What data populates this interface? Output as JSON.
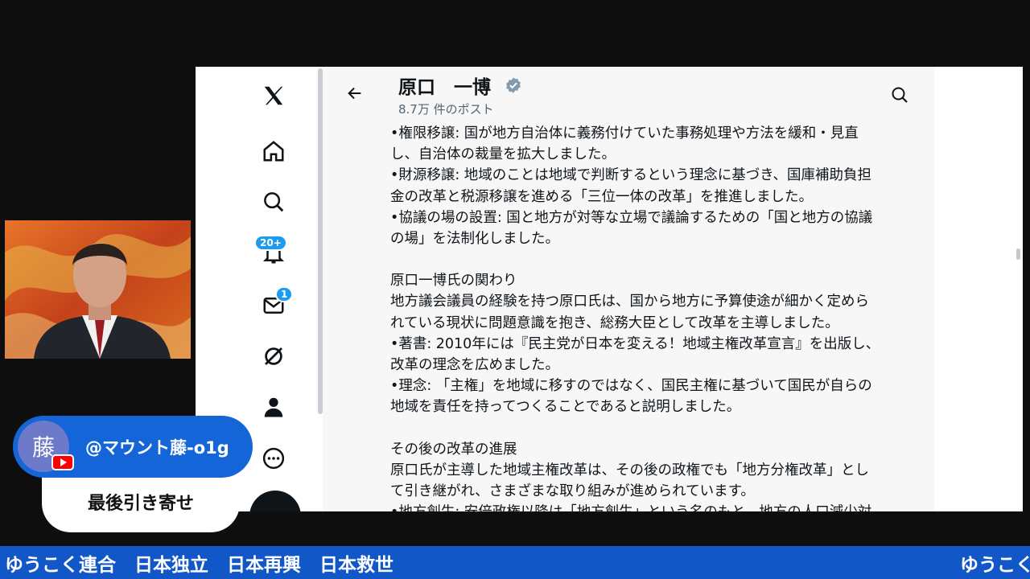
{
  "profile": {
    "name": "原口　一博",
    "post_count": "8.7万 件のポスト"
  },
  "nav": {
    "notifications_badge": "20+",
    "messages_badge": "1"
  },
  "article": {
    "lines": [
      "•権限移譲: 国が地方自治体に義務付けていた事務処理や方法を緩和・見直",
      "し、自治体の裁量を拡大しました。",
      "•財源移譲: 地域のことは地域で判断するという理念に基づき、国庫補助負担",
      "金の改革と税源移譲を進める「三位一体の改革」を推進しました。",
      "•協議の場の設置: 国と地方が対等な立場で議論するための「国と地方の協議",
      "の場」を法制化しました。",
      "",
      "原口一博氏の関わり",
      "地方議会議員の経験を持つ原口氏は、国から地方に予算使途が細かく定めら",
      "れている現状に問題意識を抱き、総務大臣として改革を主導しました。",
      "•著書: 2010年には『民主党が日本を変える！地域主権改革宣言』を出版し、",
      "改革の理念を広めました。",
      "•理念: 「主権」を地域に移すのではなく、国民主権に基づいて国民が自らの",
      "地域を責任を持ってつくることであると説明しました。",
      "",
      "その後の改革の進展",
      "原口氏が主導した地域主権改革は、その後の政権でも「地方分権改革」とし",
      "て引き継がれ、さまざまな取り組みが進められています。",
      "•地方創生: 安倍政権以降は「地方創生」という名のもと、地方の人口減少対"
    ]
  },
  "chat": {
    "avatar_char": "藤",
    "username": "@マウント藤-o1g",
    "message": "最後引き寄せ"
  },
  "ticker": {
    "text": "ゆうこく連合　日本独立　日本再興　日本救世",
    "repeat": "ゆうこく"
  },
  "colors": {
    "accent_blue": "#1d9bf0",
    "ticker_bg": "#1257c8",
    "chat_pill": "#1466d8"
  }
}
